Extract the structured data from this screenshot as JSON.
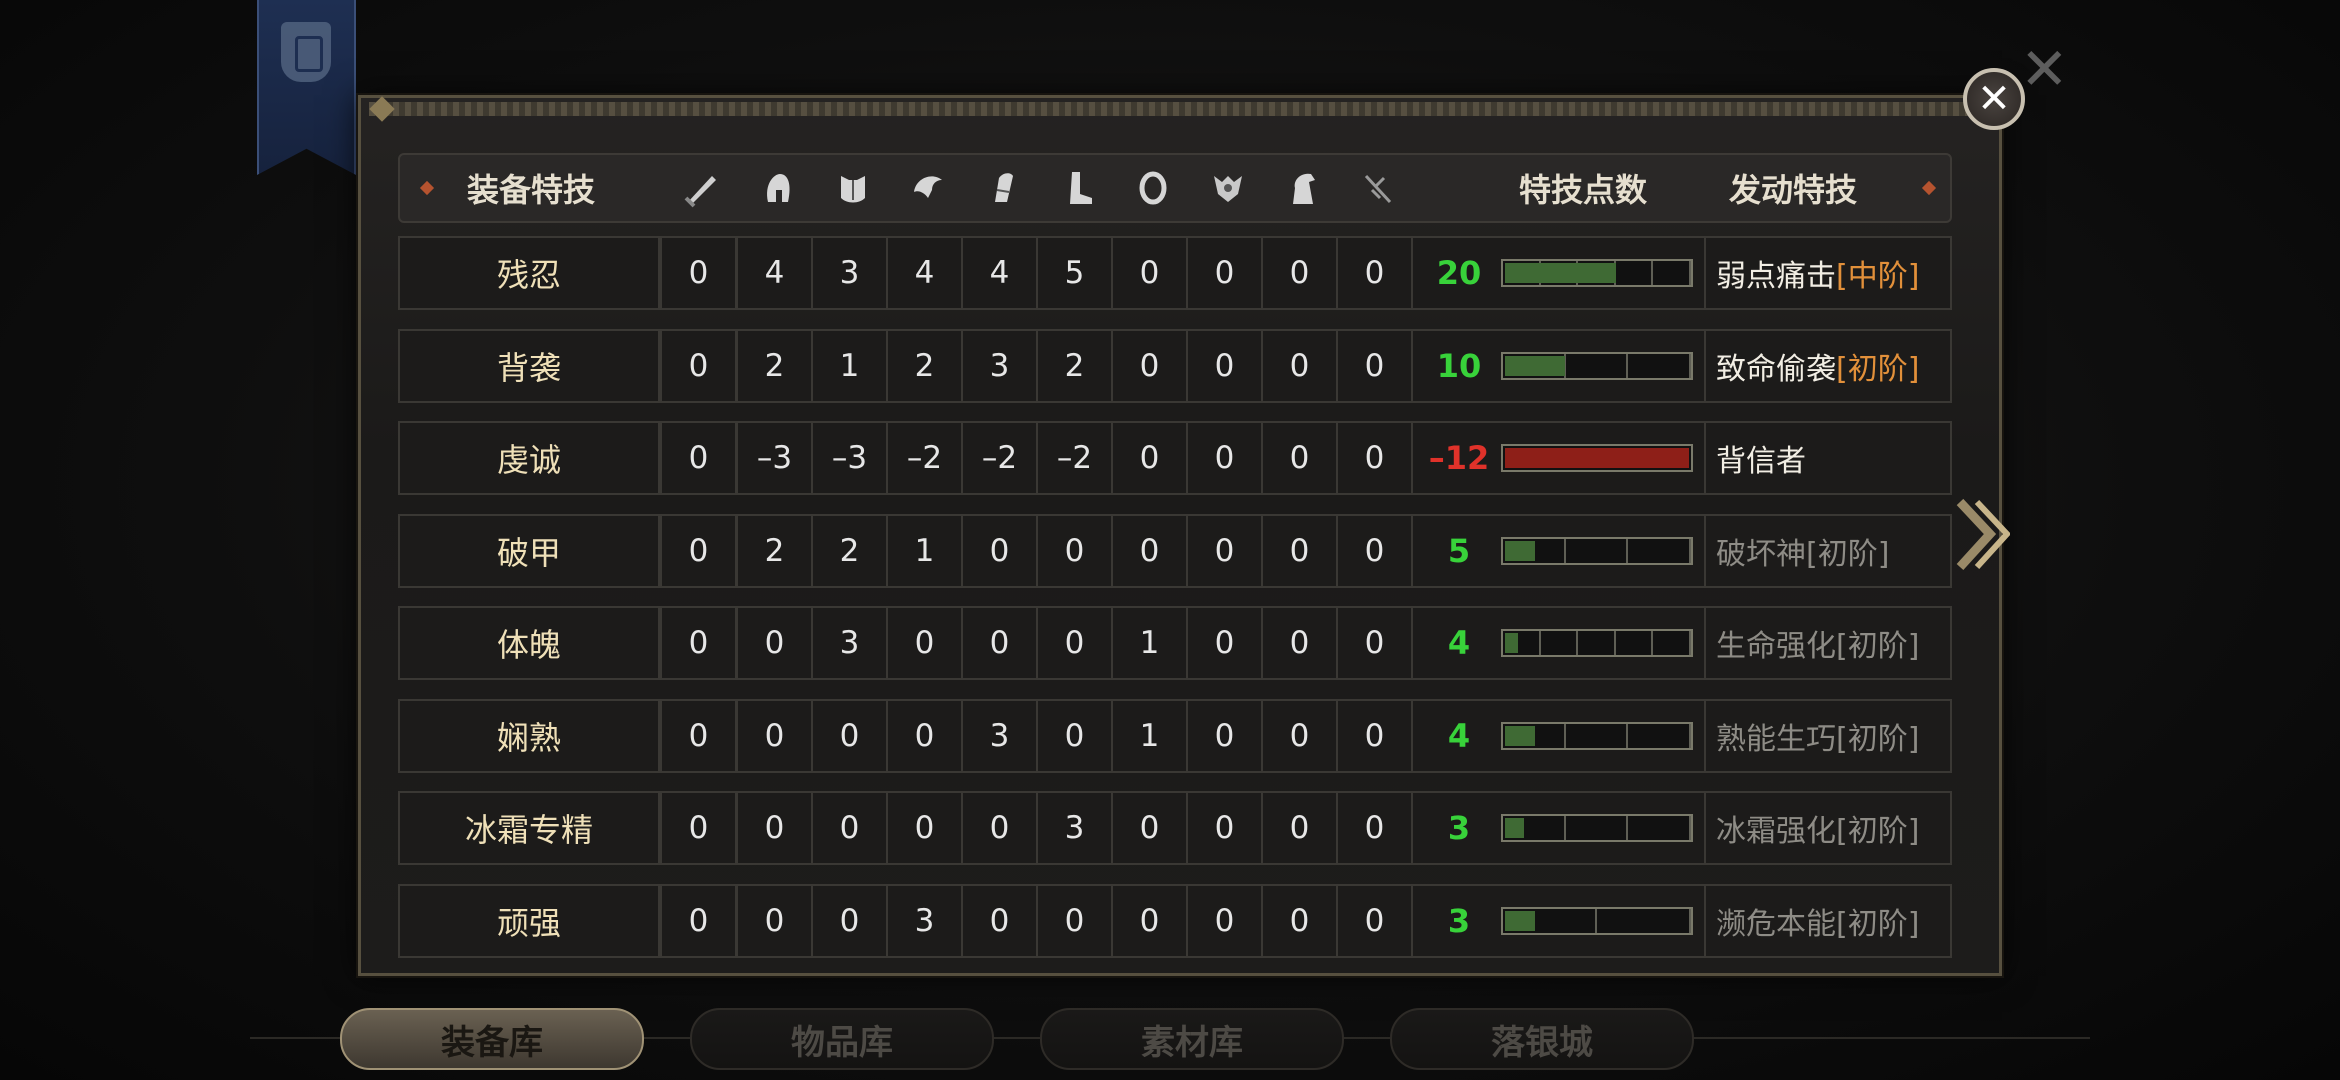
{
  "header": {
    "skill_label": "装备特技",
    "points_label": "特技点数",
    "active_label": "发动特技",
    "slot_icons": [
      "sword-icon",
      "helmet-icon",
      "chest-armor-icon",
      "shoulder-icon",
      "bracer-icon",
      "boots-icon",
      "ring-icon",
      "amulet-icon",
      "horse-icon",
      "weapon-misc-icon"
    ]
  },
  "rows": [
    {
      "name": "残忍",
      "values": [
        "0",
        "4",
        "3",
        "4",
        "4",
        "5",
        "0",
        "0",
        "0",
        "0"
      ],
      "points": "20",
      "point_value": 20,
      "bar_segments": 5,
      "bar_filled_fraction": 0.6,
      "negative": false,
      "skill": "弱点痛击",
      "tier": "[中阶]",
      "active": true
    },
    {
      "name": "背袭",
      "values": [
        "0",
        "2",
        "1",
        "2",
        "3",
        "2",
        "0",
        "0",
        "0",
        "0"
      ],
      "points": "10",
      "point_value": 10,
      "bar_segments": 3,
      "bar_filled_fraction": 0.33,
      "negative": false,
      "skill": "致命偷袭",
      "tier": "[初阶]",
      "active": true
    },
    {
      "name": "虔诚",
      "values": [
        "0",
        "–3",
        "–3",
        "–2",
        "–2",
        "–2",
        "0",
        "0",
        "0",
        "0"
      ],
      "points": "–12",
      "point_value": -12,
      "bar_segments": 1,
      "bar_filled_fraction": 1,
      "negative": true,
      "skill": "背信者",
      "tier": "",
      "active": true
    },
    {
      "name": "破甲",
      "values": [
        "0",
        "2",
        "2",
        "1",
        "0",
        "0",
        "0",
        "0",
        "0",
        "0"
      ],
      "points": "5",
      "point_value": 5,
      "bar_segments": 3,
      "bar_filled_fraction": 0.17,
      "negative": false,
      "skill": "破坏神",
      "tier": "[初阶]",
      "active": false
    },
    {
      "name": "体魄",
      "values": [
        "0",
        "0",
        "3",
        "0",
        "0",
        "0",
        "1",
        "0",
        "0",
        "0"
      ],
      "points": "4",
      "point_value": 4,
      "bar_segments": 5,
      "bar_filled_fraction": 0.08,
      "negative": false,
      "skill": "生命强化",
      "tier": "[初阶]",
      "active": false
    },
    {
      "name": "娴熟",
      "values": [
        "0",
        "0",
        "0",
        "0",
        "3",
        "0",
        "1",
        "0",
        "0",
        "0"
      ],
      "points": "4",
      "point_value": 4,
      "bar_segments": 3,
      "bar_filled_fraction": 0.17,
      "negative": false,
      "skill": "熟能生巧",
      "tier": "[初阶]",
      "active": false
    },
    {
      "name": "冰霜专精",
      "values": [
        "0",
        "0",
        "0",
        "0",
        "0",
        "3",
        "0",
        "0",
        "0",
        "0"
      ],
      "points": "3",
      "point_value": 3,
      "bar_segments": 3,
      "bar_filled_fraction": 0.11,
      "negative": false,
      "skill": "冰霜强化",
      "tier": "[初阶]",
      "active": false
    },
    {
      "name": "顽强",
      "values": [
        "0",
        "0",
        "0",
        "3",
        "0",
        "0",
        "0",
        "0",
        "0",
        "0"
      ],
      "points": "3",
      "point_value": 3,
      "bar_segments": 2,
      "bar_filled_fraction": 0.17,
      "negative": false,
      "skill": "濒危本能",
      "tier": "[初阶]",
      "active": false
    }
  ],
  "tabs": [
    "装备库",
    "物品库",
    "素材库",
    "落银城"
  ],
  "active_tab": 0,
  "colors": {
    "positive": "#38d23a",
    "negative": "#e0322a",
    "tier_active": "#e2903a",
    "name": "#efe0b8",
    "bar_fill": "#3f6a34",
    "bar_negative": "#8e1f18"
  }
}
